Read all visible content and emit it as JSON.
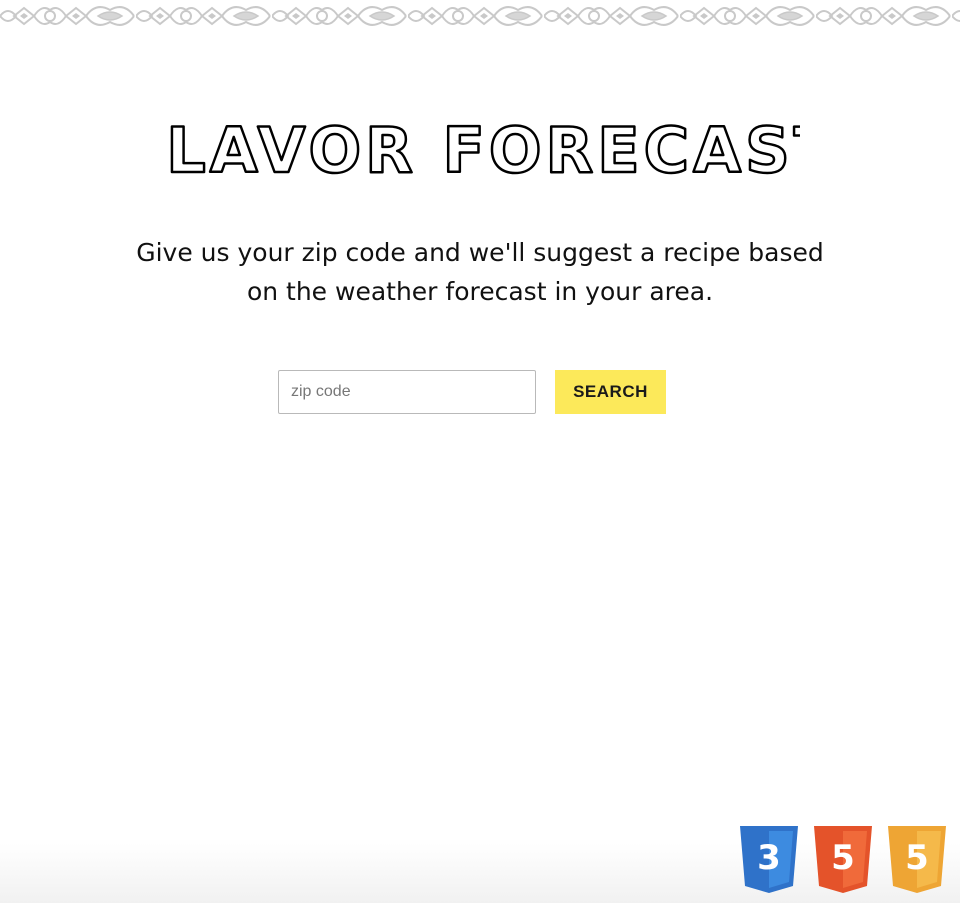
{
  "header": {
    "title": "FLAVOR FORECAST"
  },
  "intro": {
    "line1": "Give us your zip code and we'll suggest a recipe based",
    "line2": "on the weather forecast in your area."
  },
  "search": {
    "placeholder": "zip code",
    "value": "",
    "button_label": "SEARCH"
  },
  "badges": [
    {
      "icon": "css3-icon",
      "label": "3",
      "color": "#2f72c9"
    },
    {
      "icon": "html5-icon",
      "label": "5",
      "color": "#e4532a"
    },
    {
      "icon": "html5-icon",
      "label": "5",
      "color": "#eea534"
    }
  ],
  "colors": {
    "accent": "#fce95a",
    "border_pattern": "#c9c9c9",
    "text": "#111111"
  }
}
